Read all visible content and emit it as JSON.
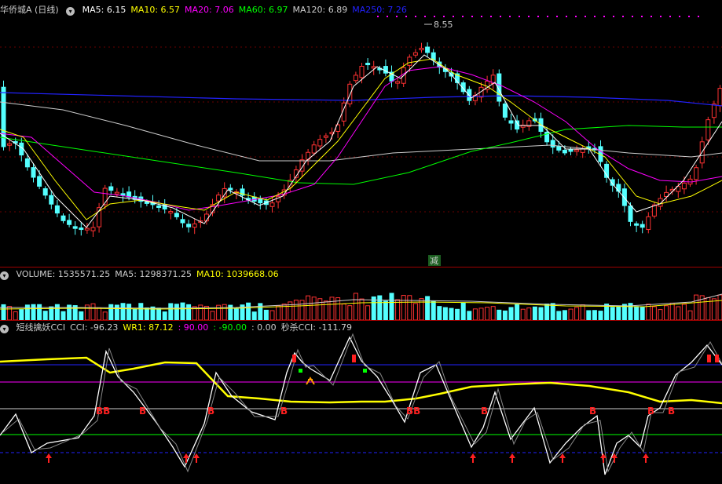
{
  "main_panel": {
    "title": "华侨城A (日线)",
    "indicators": [
      {
        "label": "MA5: 6.15",
        "color": "#ffffff"
      },
      {
        "label": "MA10: 6.57",
        "color": "#ffff00"
      },
      {
        "label": "MA20: 7.06",
        "color": "#ff00ff"
      },
      {
        "label": "MA60: 6.97",
        "color": "#00ff00"
      },
      {
        "label": "MA120: 6.89",
        "color": "#cccccc"
      },
      {
        "label": "MA250: 7.26",
        "color": "#2222ff"
      }
    ],
    "high_label": "8.55",
    "signal_label": "减"
  },
  "volume_panel": {
    "indicators": [
      {
        "label": "VOLUME: 1535571.25",
        "color": "#cccccc"
      },
      {
        "label": "MA5: 1298371.25",
        "color": "#cccccc"
      },
      {
        "label": "MA10: 1039668.06",
        "color": "#ffff00"
      }
    ]
  },
  "osc_panel": {
    "indicators": [
      {
        "label": "短线擒妖CCI",
        "color": "#cccccc"
      },
      {
        "label": "CCI: -96.23",
        "color": "#cccccc"
      },
      {
        "label": "WR1: 87.12",
        "color": "#ffff00"
      },
      {
        "label": ": 90.00",
        "color": "#ff00ff"
      },
      {
        "label": ": -90.00",
        "color": "#00ff00"
      },
      {
        "label": ": 0.00",
        "color": "#cccccc"
      },
      {
        "label": "秒杀CCI: -111.79",
        "color": "#cccccc"
      }
    ],
    "marker_labels": [
      "BB",
      "B",
      "B",
      "B",
      "BB",
      "B",
      "B",
      "B",
      "B"
    ]
  },
  "chart_data": {
    "type": "candlestick",
    "price_range": [
      5.0,
      9.0
    ],
    "colors": {
      "up": "#ff3232",
      "down": "#54ffff",
      "ma5": "#ffffff",
      "ma10": "#ffff00",
      "ma20": "#ff00ff",
      "ma60": "#00ff00",
      "ma120": "#cccccc",
      "ma250": "#2222ff"
    }
  }
}
